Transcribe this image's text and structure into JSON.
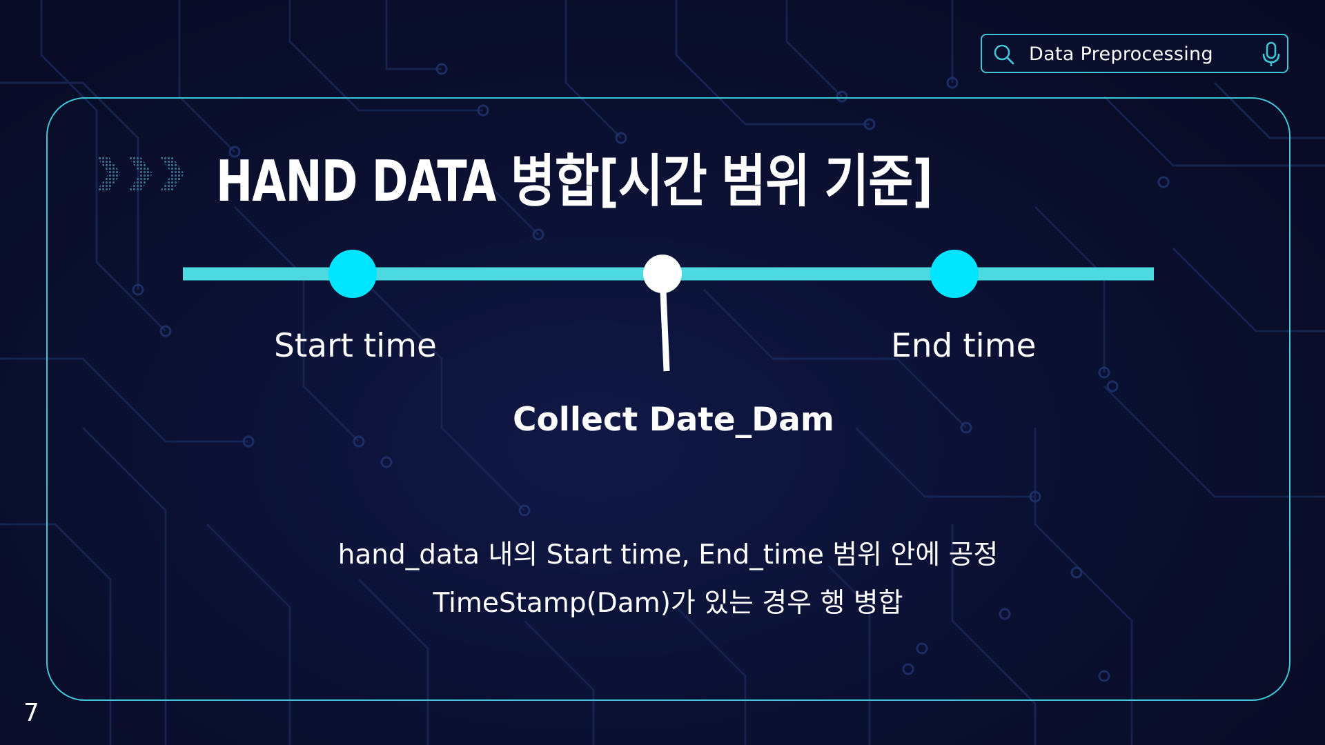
{
  "search": {
    "value": "Data Preprocessing"
  },
  "title": "HAND DATA 병합[시간 범위 기준]",
  "timeline": {
    "start_label": "Start time",
    "end_label": "End time",
    "marker_label": "Collect Date_Dam"
  },
  "description": {
    "line1": "hand_data 내의 Start time, End_time 범위 안에 공정",
    "line2": "TimeStamp(Dam)가 있는 경우 행 병합"
  },
  "page_number": "7",
  "colors": {
    "accent": "#00e5ff",
    "line": "#4dd9e0",
    "border": "#3fc6d6",
    "background": "#0a0e2a",
    "marker": "#ffffff"
  },
  "icons": {
    "search": "search-icon",
    "mic": "mic-icon",
    "chevrons": "chevron-right-icon"
  }
}
